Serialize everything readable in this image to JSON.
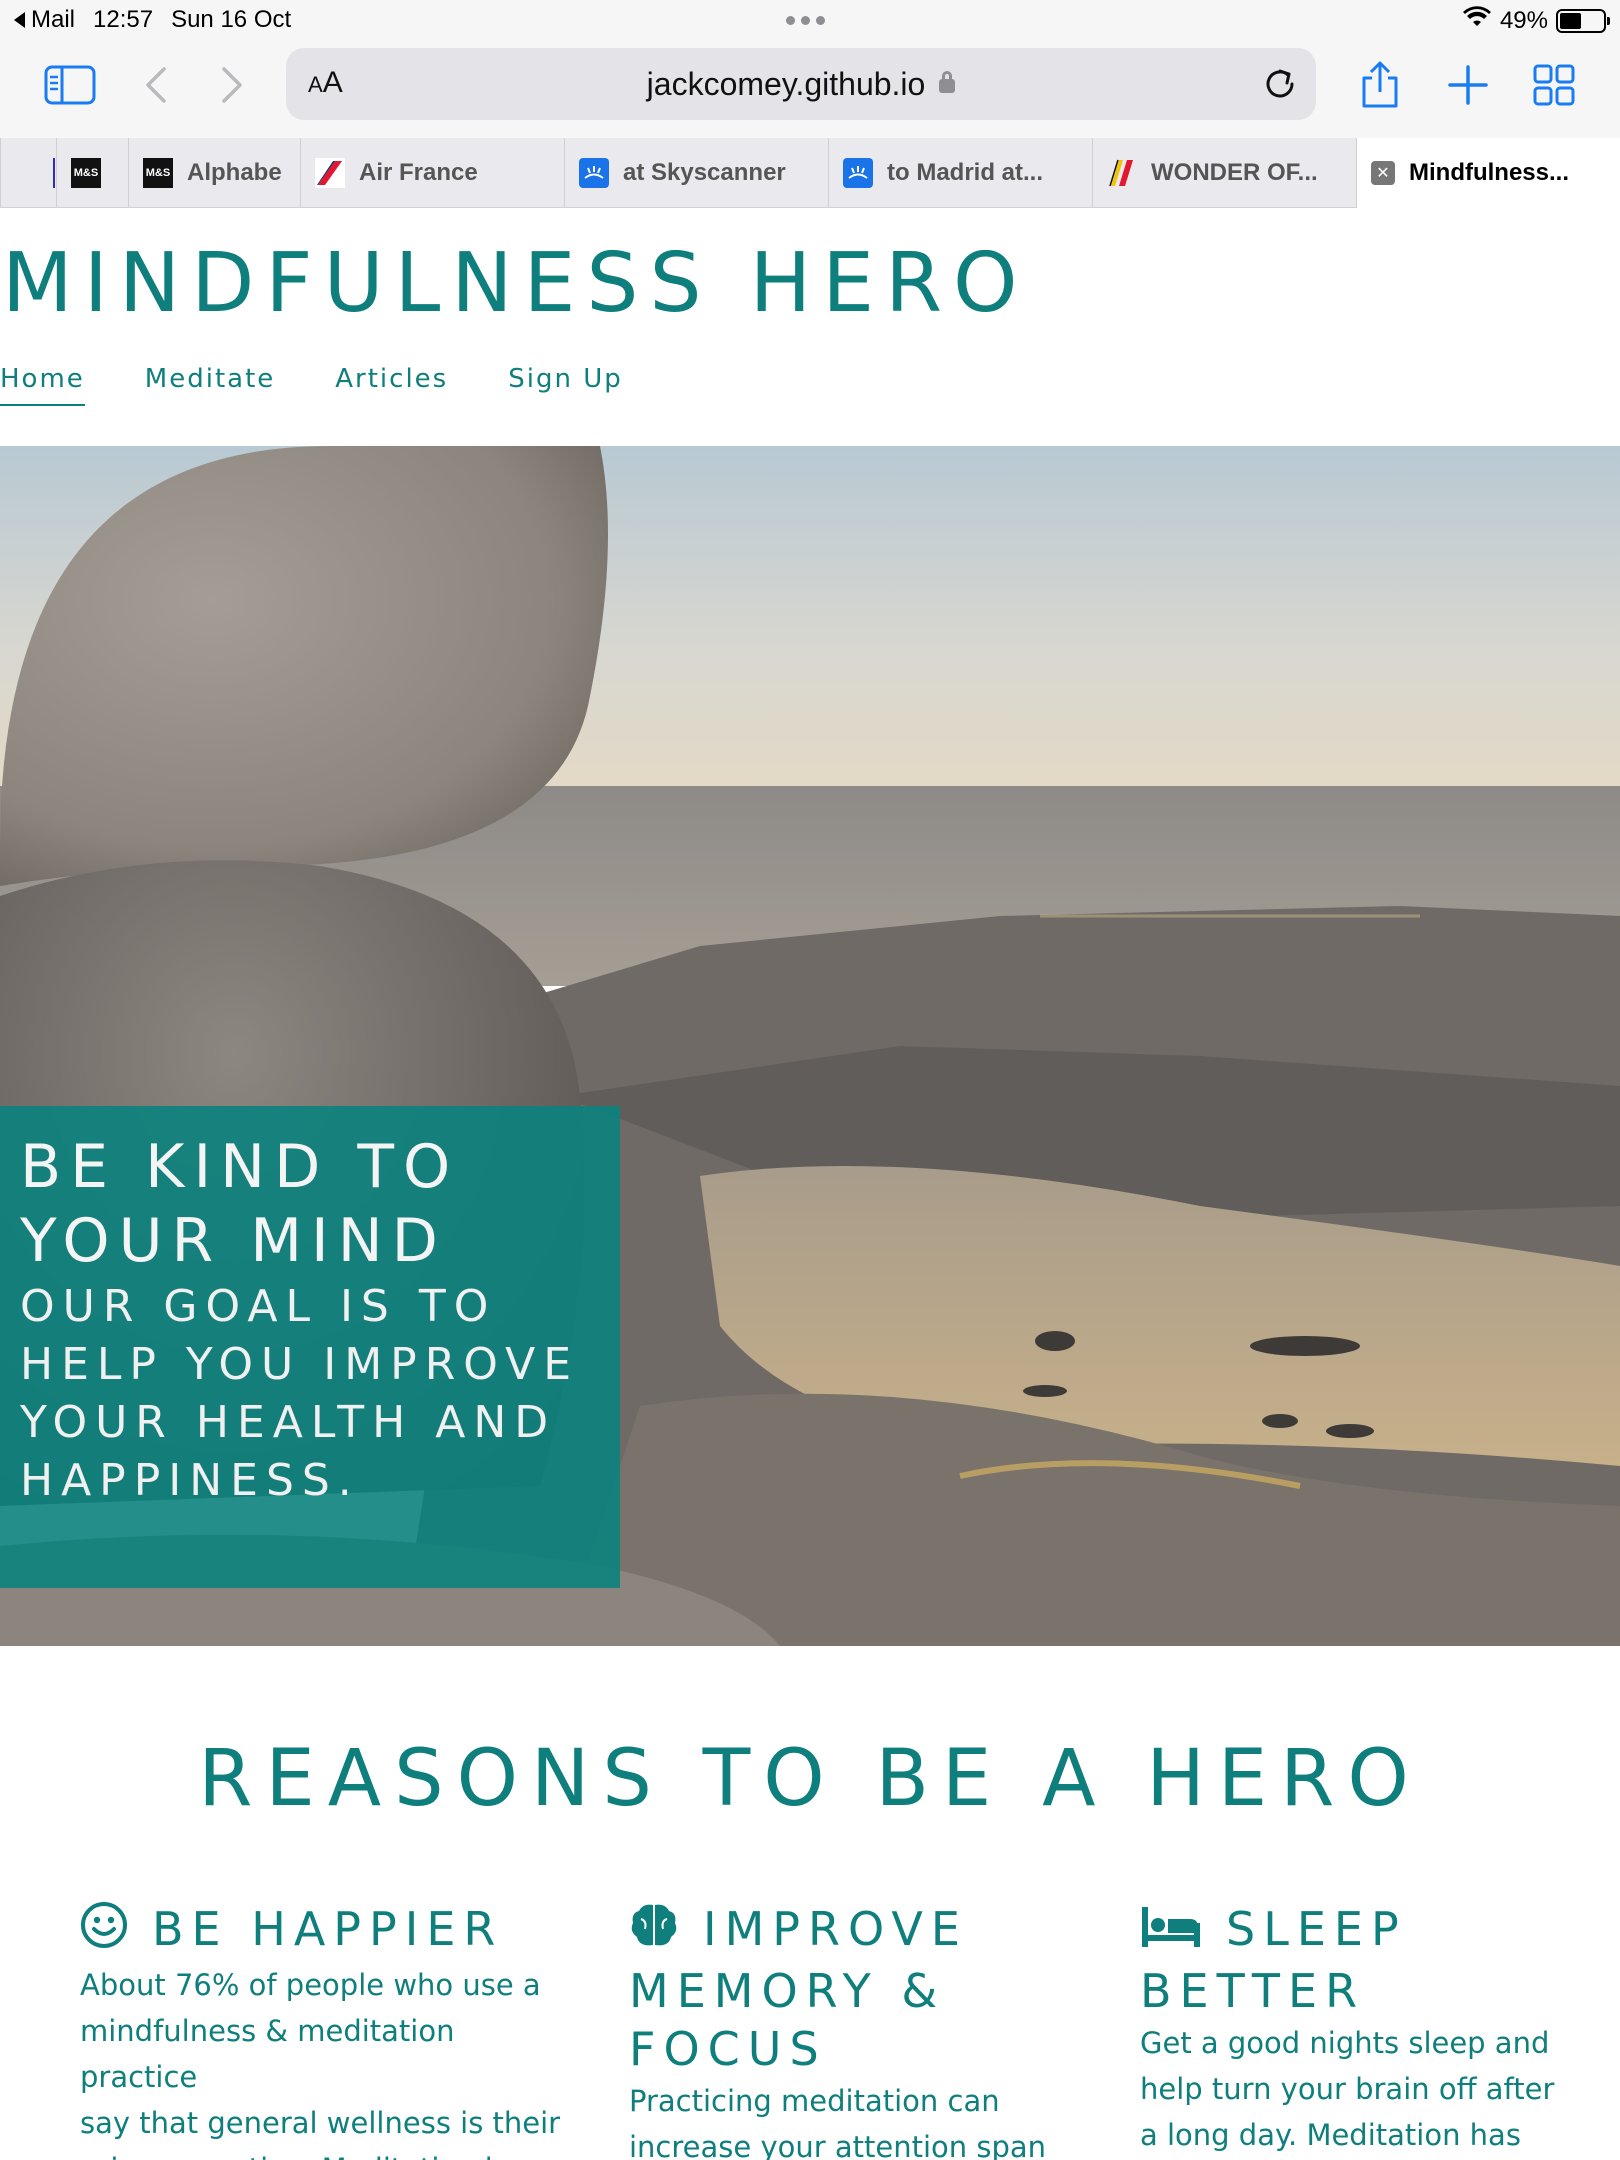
{
  "status_bar": {
    "back_app": "Mail",
    "time": "12:57",
    "date": "Sun 16 Oct",
    "battery": "49%",
    "battery_level": 0.49
  },
  "browser": {
    "text_size_label": "AA",
    "url": "jackcomey.github.io",
    "tabs": [
      {
        "label": "",
        "icon": "mks-icon"
      },
      {
        "label": "Alphabe",
        "icon": "mks-icon"
      },
      {
        "label": "Air France",
        "icon": "air-france-icon"
      },
      {
        "label": "at Skyscanner",
        "icon": "skyscanner-icon"
      },
      {
        "label": "to Madrid at...",
        "icon": "skyscanner-icon"
      },
      {
        "label": "WONDER OF...",
        "icon": "flag-icon"
      },
      {
        "label": "Mindfulness...",
        "icon": "close-icon"
      }
    ],
    "active_tab_index": 6
  },
  "site": {
    "title": "MINDFULNESS HERO",
    "nav": [
      "Home",
      "Meditate",
      "Articles",
      "Sign Up"
    ],
    "nav_active": "Home",
    "hero": {
      "heading_line1": "BE KIND TO",
      "heading_line2": "YOUR MIND",
      "sub_line1": "OUR GOAL IS TO",
      "sub_line2": "HELP YOU IMPROVE",
      "sub_line3": "YOUR HEALTH AND",
      "sub_line4": "HAPPINESS."
    },
    "reasons_title": "REASONS TO BE A HERO",
    "reasons": [
      {
        "icon": "smile-icon",
        "title_line1": "BE HAPPIER",
        "title_line2": "",
        "title_line3": "",
        "text": [
          "About 76% of people who use a",
          "mindfulness & meditation practice",
          "say that general wellness is their",
          "primary motive. Meditation has"
        ]
      },
      {
        "icon": "brain-icon",
        "title_line1": "IMPROVE",
        "title_line2": "MEMORY &",
        "title_line3": "FOCUS",
        "text": [
          "Practicing meditation can",
          "increase your attention span"
        ]
      },
      {
        "icon": "bed-icon",
        "title_line1": "SLEEP",
        "title_line2": "BETTER",
        "title_line3": "",
        "text": [
          "Get a good nights sleep and",
          "help turn your brain off after",
          "a long day. Meditation has"
        ]
      }
    ],
    "colors": {
      "accent": "#0e7f7c",
      "hero_box": "#0b827d"
    }
  }
}
